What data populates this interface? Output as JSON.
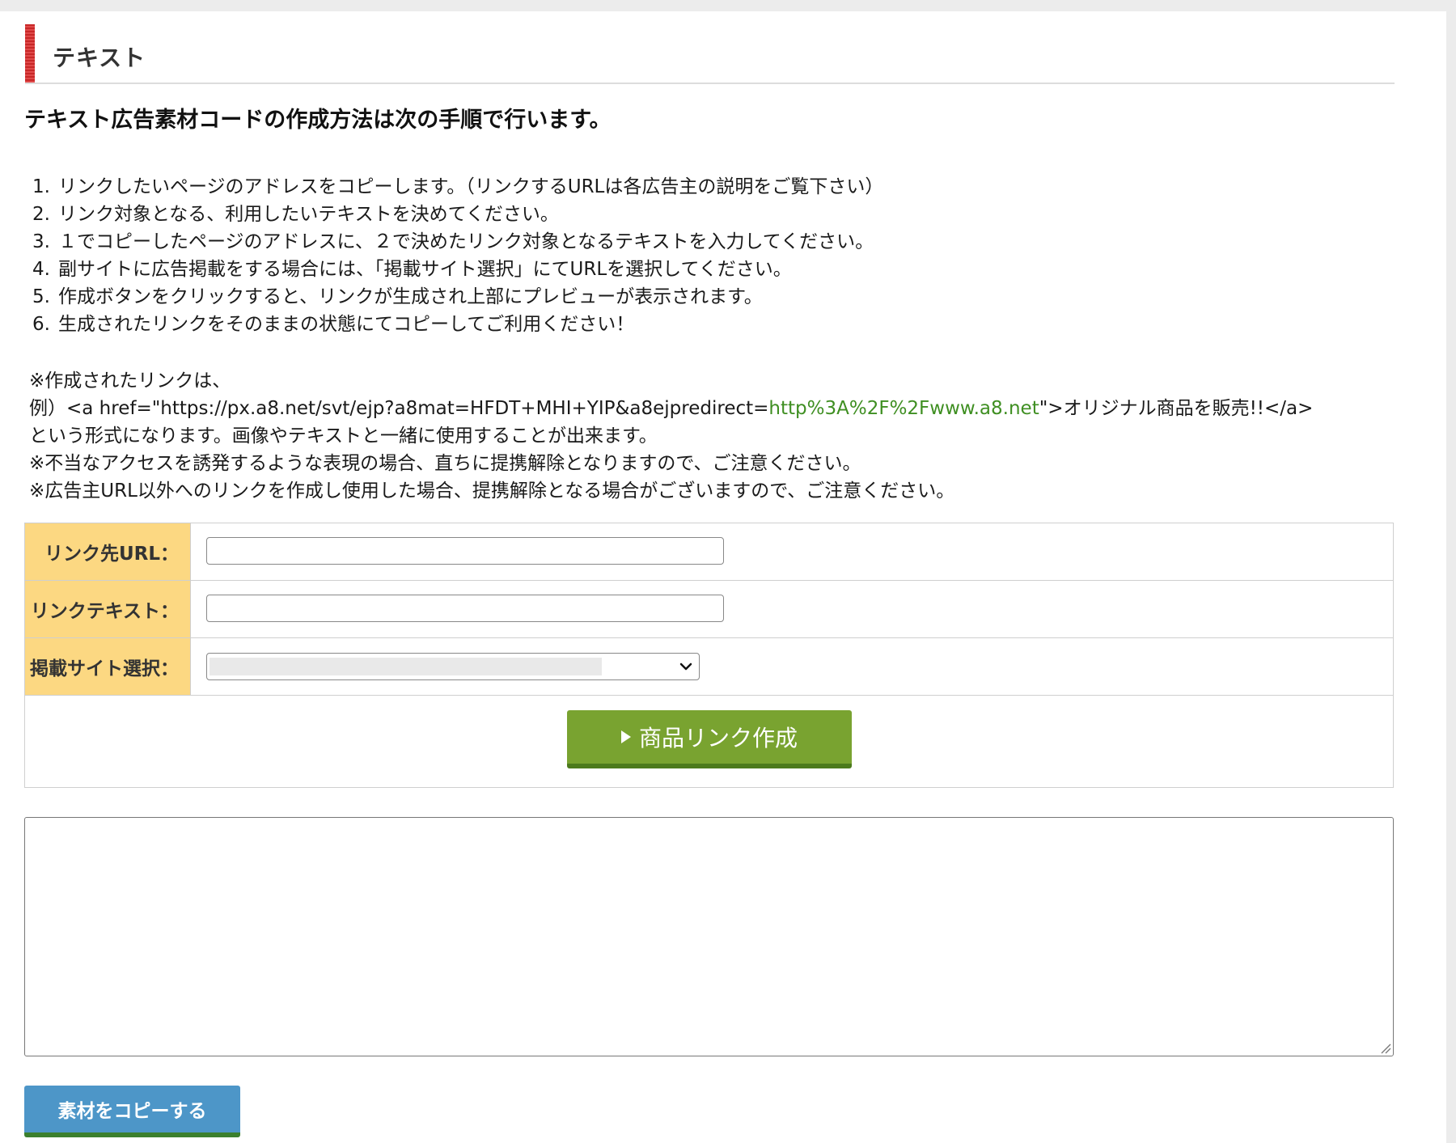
{
  "section": {
    "title": "テキスト"
  },
  "lead": "テキスト広告素材コードの作成方法は次の手順で行います。",
  "steps": [
    {
      "num": "1.",
      "text": "リンクしたいページのアドレスをコピーします。（リンクするURLは各広告主の説明をご覧下さい）"
    },
    {
      "num": "2.",
      "text": "リンク対象となる、利用したいテキストを決めてください。"
    },
    {
      "num": "3.",
      "text": "１でコピーしたページのアドレスに、２で決めたリンク対象となるテキストを入力してください。"
    },
    {
      "num": "4.",
      "text": "副サイトに広告掲載をする場合には、「掲載サイト選択」にてURLを選択してください。"
    },
    {
      "num": "5.",
      "text": "作成ボタンをクリックすると、リンクが生成され上部にプレビューが表示されます。"
    },
    {
      "num": "6.",
      "text": "生成されたリンクをそのままの状態にてコピーしてご利用ください！"
    }
  ],
  "notes": {
    "line1": "※作成されたリンクは、",
    "example_prefix": "例）<a href=\"https://px.a8.net/svt/ejp?a8mat=HFDT+MHI+YIP&a8ejpredirect=",
    "example_url": "http%3A%2F%2Fwww.a8.net",
    "example_suffix": "\">オリジナル商品を販売!!</a>",
    "line3": "という形式になります。画像やテキストと一緒に使用することが出来ます。",
    "line4": "※不当なアクセスを誘発するような表現の場合、直ちに提携解除となりますので、ご注意ください。",
    "line5": "※広告主URL以外へのリンクを作成し使用した場合、提携解除となる場合がございますので、ご注意ください。"
  },
  "form": {
    "url_label": "リンク先URL：",
    "url_value": "",
    "text_label": "リンクテキスト：",
    "text_value": "",
    "site_label": "掲載サイト選択：",
    "site_selected": "",
    "create_button": "商品リンク作成"
  },
  "output": {
    "value": ""
  },
  "copy_button": "素材をコピーする",
  "colors": {
    "header_bar": "#d03030",
    "label_bg": "#fcd882",
    "create_button": "#79a330",
    "copy_button": "#4d96c8",
    "link_green": "#3f8f22"
  }
}
